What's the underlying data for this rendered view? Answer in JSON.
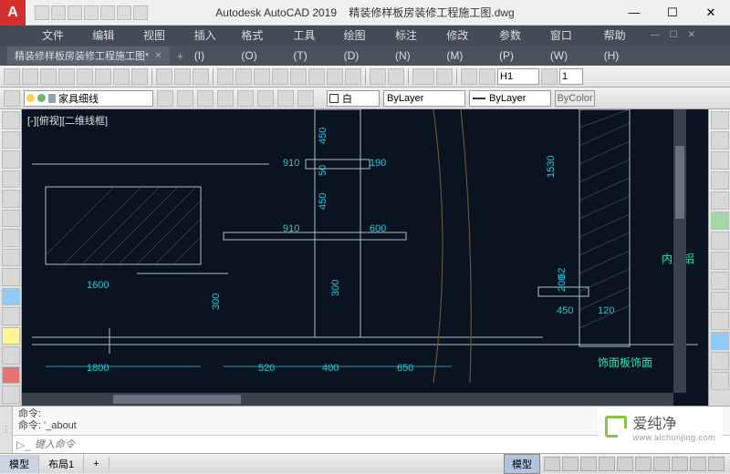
{
  "app": {
    "name": "Autodesk AutoCAD 2019",
    "file": "精装修样板房装修工程施工图.dwg"
  },
  "menu": [
    "文件(F)",
    "编辑(E)",
    "视图(V)",
    "插入(I)",
    "格式(O)",
    "工具(T)",
    "绘图(D)",
    "标注(N)",
    "修改(M)",
    "参数(P)",
    "窗口(W)",
    "帮助(H)"
  ],
  "doctab": {
    "name": "精装修样板房装修工程施工图*"
  },
  "ribbon": {
    "textstyle": "H1",
    "textheight": "1"
  },
  "properties": {
    "layer": "家具细线",
    "color": "白",
    "linetype": "ByLayer",
    "lineweight": "ByLayer",
    "plotstyle": "ByColor"
  },
  "viewport": {
    "label": "[-][俯视][二维线框]"
  },
  "dims": {
    "d1600": "1600",
    "d1800": "1800",
    "d910a": "910",
    "d910b": "910",
    "d450a": "450",
    "d450b": "450",
    "d450c": "450",
    "d50": "50",
    "d190": "190",
    "d600": "600",
    "d520": "520",
    "d400": "400",
    "d650": "650",
    "d300a": "300",
    "d300b": "300",
    "d1530": "1530",
    "d62": "62",
    "d200": "200",
    "d120": "120"
  },
  "annotations": {
    "panel": "饰面板饰面",
    "inner": "内贴铝"
  },
  "command": {
    "hist1": "命令:",
    "hist2": "命令: '_about",
    "placeholder": "键入命令"
  },
  "status": {
    "model": "模型",
    "layout1": "布局1",
    "modelbtn": "模型"
  },
  "watermark": {
    "text": "爱纯净",
    "sub": "www.aichunjing.com"
  },
  "chart_data": {
    "type": "cad-drawing",
    "title": "精装修样板房装修工程施工图",
    "xlabel": "",
    "ylabel": "",
    "unit_hint": "mm",
    "horizontal_dimensions": [
      1600,
      1800,
      910,
      910,
      190,
      600,
      520,
      400,
      650,
      450,
      120
    ],
    "vertical_dimensions": [
      450,
      50,
      450,
      300,
      300,
      1530,
      62,
      200
    ],
    "annotations": [
      "饰面板饰面",
      "内贴铝"
    ],
    "viewport": "[-][俯视][二维线框]"
  }
}
